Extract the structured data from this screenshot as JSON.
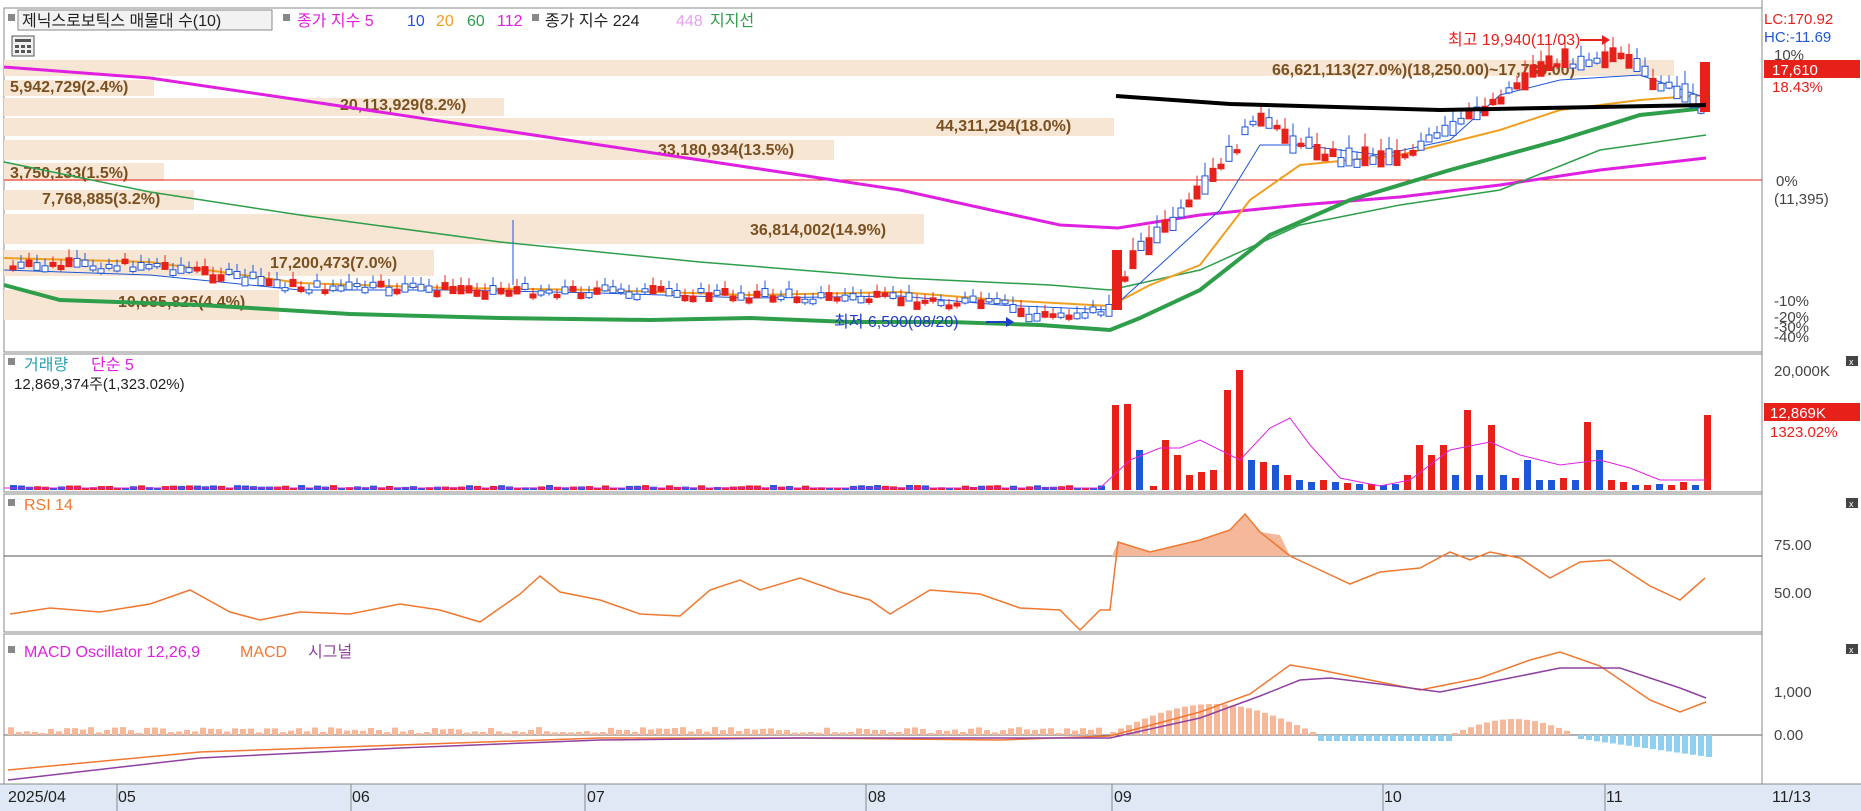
{
  "colors": {
    "up": "#e8201a",
    "down": "#1e56d8",
    "price_box": "#e8201a",
    "vol_box": "#e8201a",
    "ma5": "#1e56d8",
    "ma20": "#f0a020",
    "ma60": "#2e9e4a",
    "ma112": "#e020e0",
    "ma224_pink": "#e020e0",
    "support": "#000000",
    "rsi": "#f07830",
    "macd": "#f07830",
    "signal": "#9040a0",
    "osc_pos": "#f5b89a",
    "osc_neg": "#8fd0f0",
    "vp_fill": "#f8e6d4",
    "vp_text": "#7a5020"
  },
  "header": {
    "stock_label": "제닉스로보틱스 매물대 수(10)",
    "close_index_label": "종가 지수 5",
    "ma10": "10",
    "ma20": "20",
    "ma60": "60",
    "ma112": "112",
    "close_index_224": "종가 지수 224",
    "ma448": "448",
    "support_line": "지지선"
  },
  "price_panel": {
    "lc": "LC:170.92",
    "hc": "HC:-11.69",
    "current_price": "17,610",
    "current_pct": "18.43%",
    "axis_ticks": [
      "10%",
      "0%",
      "(11,395)",
      "-10%",
      "-20%",
      "-30%",
      "-40%"
    ],
    "high_label": "최고 19,940(11/03)",
    "low_label": "최저 6,500(08/20)",
    "volume_profile": [
      {
        "label": "66,621,113(27.0%)(18,250.00)~17,780.00)"
      },
      {
        "label": "5,942,729(2.4%)"
      },
      {
        "label": "20,113,929(8.2%)"
      },
      {
        "label": "44,311,294(18.0%)"
      },
      {
        "label": "33,180,934(13.5%)"
      },
      {
        "label": "3,750,133(1.5%)"
      },
      {
        "label": "7,768,885(3.2%)"
      },
      {
        "label": "36,814,002(14.9%)"
      },
      {
        "label": "17,200,473(7.0%)"
      },
      {
        "label": "10,985,825(4.4%)"
      }
    ]
  },
  "volume_panel": {
    "title": "거래량",
    "ma_label": "단순 5",
    "current": "12,869,374주(1,323.02%)",
    "axis_top": "20,000K",
    "current_box": "12,869K",
    "current_pct": "1323.02%"
  },
  "rsi_panel": {
    "title": "RSI 14",
    "ticks": [
      "75.00",
      "50.00"
    ]
  },
  "macd_panel": {
    "title": "MACD Oscillator 12,26,9",
    "macd_label": "MACD",
    "signal_label": "시그널",
    "ticks": [
      "1,000",
      "0.00"
    ]
  },
  "x_axis": {
    "labels": [
      "2025/04",
      "05",
      "06",
      "07",
      "08",
      "09",
      "10",
      "11"
    ],
    "end_label": "11/13"
  }
}
